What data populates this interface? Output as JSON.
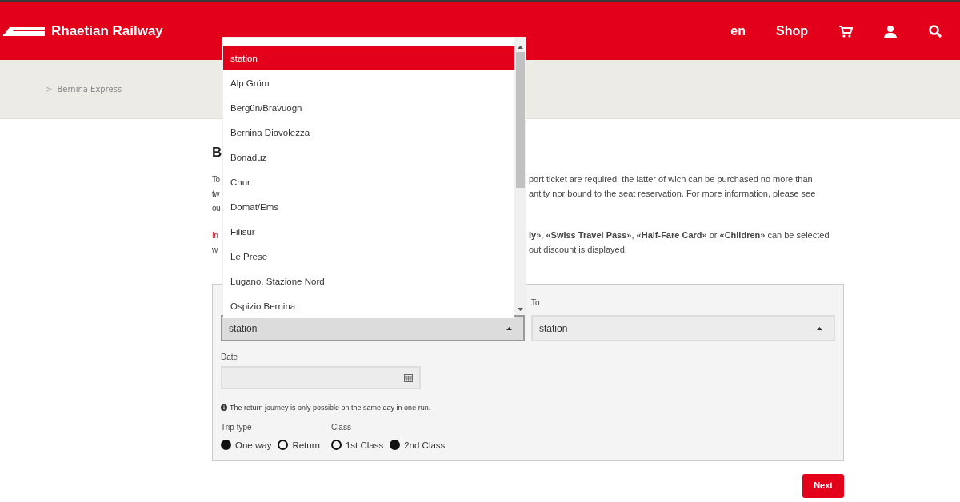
{
  "header": {
    "brand": "Rhaetian Railway",
    "nav": [
      {
        "kind": "text",
        "label": "en"
      },
      {
        "kind": "text",
        "label": "Shop"
      },
      {
        "kind": "cart"
      },
      {
        "kind": "user"
      },
      {
        "kind": "search"
      }
    ]
  },
  "breadcrumb": {
    "separator": ">",
    "label": "Bernina Express"
  },
  "heading": "B",
  "intro": [
    {
      "left": "To",
      "right": "port ticket are required, the latter of wich can be purchased no more than"
    },
    {
      "left": "tw",
      "right": "antity nor bound to the seat reservation. For more information, please see"
    },
    {
      "left": "ou"
    }
  ],
  "notice": [
    {
      "left": "In",
      "right": "**ly»**, **«Swiss Travel Pass»**, **«Half-Fare Card»** or **«Children»** can be selected"
    },
    {
      "left": "w",
      "right": "out discount is displayed."
    }
  ],
  "form": {
    "to_label": "To",
    "from_value": "station",
    "to_value": "station",
    "date_label": "Date",
    "info": "The return journey is only possible on the same day in one run.",
    "trip_label": "Trip type",
    "class_label": "Class",
    "trip_types": [
      {
        "label": "One way",
        "selected": true
      },
      {
        "label": "Return",
        "selected": false
      }
    ],
    "classes": [
      {
        "label": "1st Class",
        "selected": false
      },
      {
        "label": "2nd Class",
        "selected": true
      }
    ]
  },
  "dropdown": {
    "items": [
      {
        "label": "station",
        "selected": true
      },
      {
        "label": "Alp Grüm",
        "selected": false
      },
      {
        "label": "Bergün/Bravuogn",
        "selected": false
      },
      {
        "label": "Bernina Diavolezza",
        "selected": false
      },
      {
        "label": "Bonaduz",
        "selected": false
      },
      {
        "label": "Chur",
        "selected": false
      },
      {
        "label": "Domat/Ems",
        "selected": false
      },
      {
        "label": "Filisur",
        "selected": false
      },
      {
        "label": "Le Prese",
        "selected": false
      },
      {
        "label": "Lugano, Stazione Nord",
        "selected": false
      },
      {
        "label": "Ospizio Bernina",
        "selected": false
      }
    ]
  },
  "next_button": "Next"
}
